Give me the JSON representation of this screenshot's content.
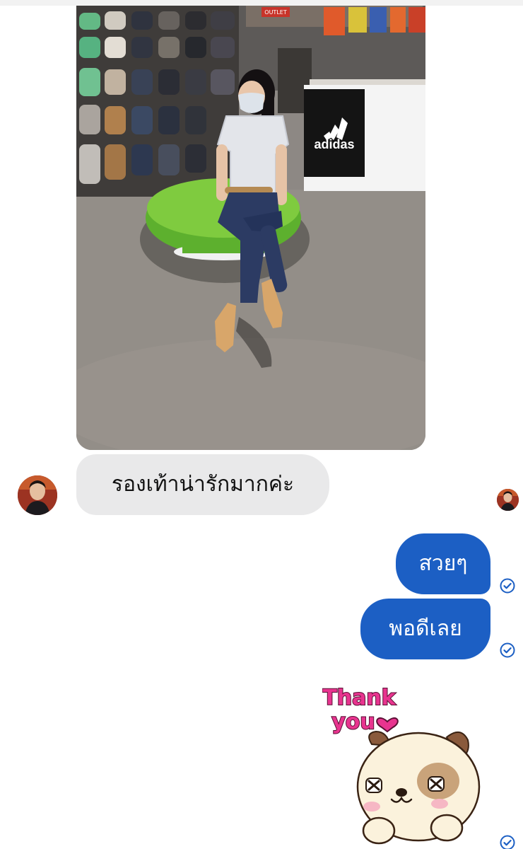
{
  "conversation": {
    "incoming_message": "รองเท้าน่ารักมากค่ะ",
    "outgoing_messages": [
      "สวยๆ",
      "พอดีเลย"
    ],
    "sticker_text": "Thank you"
  },
  "photo": {
    "store_logo_text": "adidas",
    "sign_text": "OUTLET"
  },
  "colors": {
    "outgoing_bubble": "#1c5fc4",
    "incoming_bubble": "#e9e9ea",
    "check": "#1c5fc4",
    "sticker_text": "#e8348f"
  },
  "icons": [
    "read-receipt-check-icon",
    "avatar"
  ]
}
